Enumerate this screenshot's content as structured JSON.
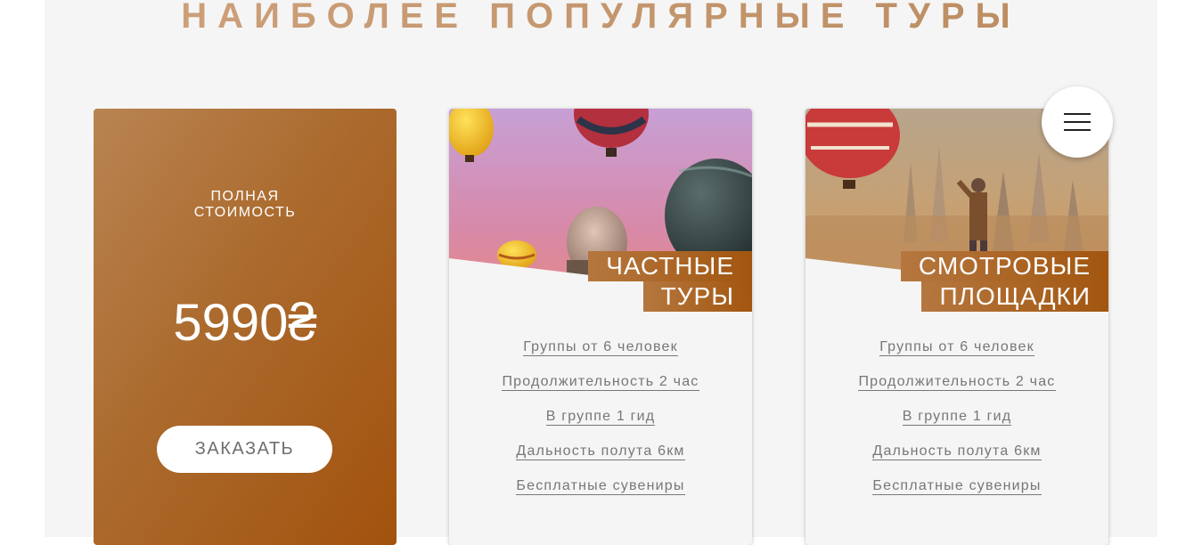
{
  "section": {
    "title": "НАИБОЛЕЕ ПОПУЛЯРНЫЕ ТУРЫ"
  },
  "price_card": {
    "label_line1": "ПОЛНАЯ",
    "label_line2": "СТОИМОСТЬ",
    "price": "5990₴",
    "order_button": "ЗАКАЗАТЬ"
  },
  "tours": [
    {
      "title_line1": "ЧАСТНЫЕ",
      "title_line2": "ТУРЫ",
      "features": [
        "Группы от 6 человек",
        "Продолжительность 2 час",
        "В группе 1 гид",
        "Дальность полута 6км",
        "Бесплатные сувениры"
      ]
    },
    {
      "title_line1": "СМОТРОВЫЕ",
      "title_line2": "ПЛОЩАДКИ",
      "features": [
        "Группы от 6 человек",
        "Продолжительность 2 час",
        "В группе 1 гид",
        "Дальность полута 6км",
        "Бесплатные сувениры"
      ]
    }
  ],
  "icons": {
    "menu": "hamburger-icon"
  },
  "colors": {
    "accent_start": "#b98452",
    "accent_end": "#a2520d",
    "title": "#c99d78",
    "panel": "#f5f5f5"
  }
}
